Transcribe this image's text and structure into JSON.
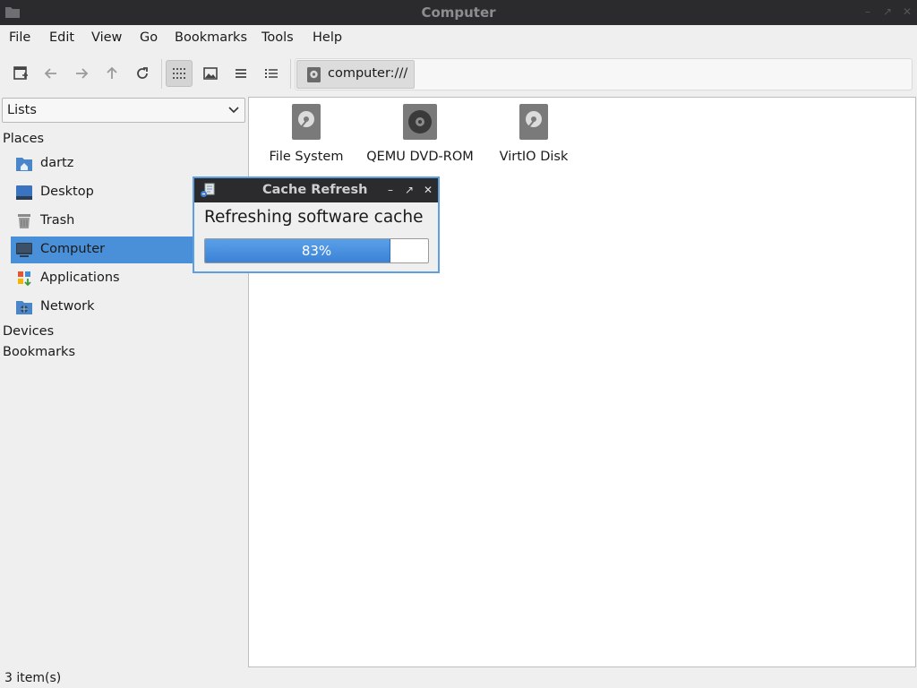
{
  "window": {
    "title": "Computer",
    "app_icon": "folder-icon"
  },
  "menubar": {
    "items": [
      "File",
      "Edit",
      "View",
      "Go",
      "Bookmarks",
      "Tools",
      "Help"
    ]
  },
  "toolbar": {
    "buttons": [
      "new-tab-icon",
      "back-icon",
      "forward-icon",
      "up-icon",
      "reload-icon",
      "icon-view-icon",
      "thumbnail-view-icon",
      "compact-view-icon",
      "detailed-list-icon"
    ],
    "active_view": "icon-view-icon",
    "location": "computer:///"
  },
  "sidebar": {
    "mode": "Lists",
    "sections": {
      "places": "Places",
      "devices": "Devices",
      "bookmarks": "Bookmarks"
    },
    "places": [
      {
        "label": "dartz",
        "icon": "home-folder-icon"
      },
      {
        "label": "Desktop",
        "icon": "desktop-icon"
      },
      {
        "label": "Trash",
        "icon": "trash-icon"
      },
      {
        "label": "Computer",
        "icon": "computer-icon",
        "selected": true
      },
      {
        "label": "Applications",
        "icon": "applications-icon"
      },
      {
        "label": "Network",
        "icon": "network-folder-icon"
      }
    ]
  },
  "files": [
    {
      "label": "File System",
      "icon": "harddisk-icon"
    },
    {
      "label": "QEMU DVD-ROM",
      "icon": "optical-drive-icon"
    },
    {
      "label": "VirtIO Disk",
      "icon": "harddisk-icon"
    }
  ],
  "status": {
    "text": "3 item(s)"
  },
  "dialog": {
    "title": "Cache Refresh",
    "message": "Refreshing software cache",
    "progress_percent": 83,
    "progress_label": "83%"
  },
  "colors": {
    "titlebar_bg": "#2b2b2e",
    "selection": "#4a90d9",
    "progress_fill": "#3b82d6",
    "dialog_border": "#5e9fe0"
  }
}
